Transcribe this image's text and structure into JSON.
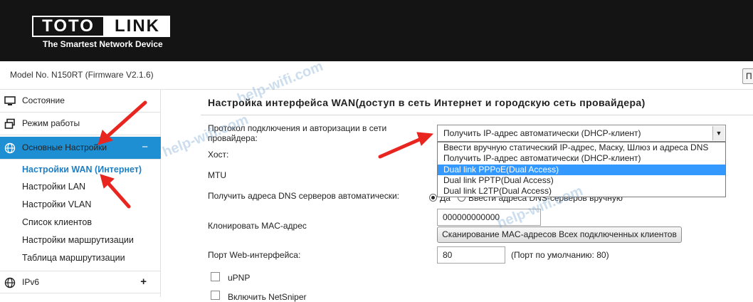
{
  "header": {
    "logo_left": "TOTO",
    "logo_right": "LINK",
    "tagline": "The Smartest Network Device"
  },
  "model_bar": {
    "text": "Model No. N150RT (Firmware V2.1.6)",
    "corner_button": "П"
  },
  "sidebar": {
    "items": [
      {
        "label": "Состояние",
        "icon": "monitor-icon"
      },
      {
        "label": "Режим работы",
        "icon": "windows-icon"
      },
      {
        "label": "Основные Настройки",
        "icon": "globe-icon",
        "active": true,
        "toggle": "−"
      }
    ],
    "sub_items": [
      {
        "label": "Настройки WAN (Интернет)",
        "current": true
      },
      {
        "label": "Настройки LAN"
      },
      {
        "label": "Настройки VLAN"
      },
      {
        "label": "Список клиентов"
      },
      {
        "label": "Настройки маршрутизации"
      },
      {
        "label": "Таблица маршрутизации"
      }
    ],
    "bottom_item": {
      "label": "IPv6",
      "icon": "globe-icon",
      "toggle": "+"
    },
    "active_color": "#1f8fd3"
  },
  "main": {
    "title": "Настройка интерфейса WAN(доступ в сеть Интернет и городскую сеть провайдера)",
    "protocol_label": "Протокол подключения и авторизации в сети провайдера:",
    "protocol_value": "Получить IP-адрес автоматически (DHCP-клиент)",
    "dropdown_options": [
      "Ввести вручную статический IP-адрес, Маску, Шлюз и адреса DNS",
      "Получить IP-адрес автоматически (DHCP-клиент)",
      "Dual link PPPoE(Dual Access)",
      "Dual link PPTP(Dual Access)",
      "Dual link L2TP(Dual Access)"
    ],
    "highlighted_option_index": 2,
    "host_label": "Хост:",
    "mtu_label": "MTU",
    "dns_label": "Получить адреса DNS серверов автоматически:",
    "dns_yes": "Да",
    "dns_manual": "Ввести адреса DNS-серверов вручную",
    "mac_label": "Клонировать MAC-адрес",
    "mac_value": "000000000000",
    "scan_button": "Сканирование MAC-адресов Всех подключенных клиентов",
    "web_port_label": "Порт Web-интерфейса:",
    "web_port_value": "80",
    "web_port_hint": "(Порт по умолчанию: 80)",
    "upnp_label": "uPNP",
    "netsniper_label": "Включить NetSniper"
  },
  "watermarks": [
    "help-wifi.com",
    "help-wifi.com",
    "help-wifi.com"
  ],
  "colors": {
    "header_bg": "#141414",
    "accent": "#1f8fd3",
    "highlight": "#3399ff",
    "annotation_arrow": "#e8261f"
  }
}
